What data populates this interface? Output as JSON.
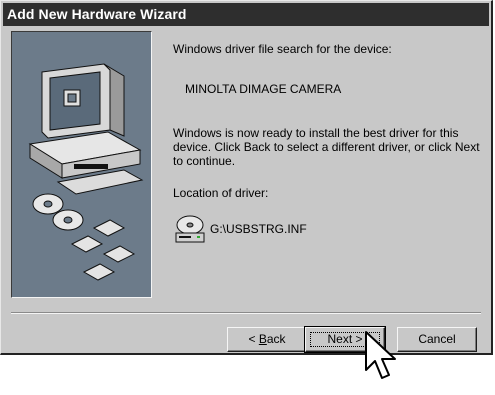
{
  "window": {
    "title": "Add New Hardware Wizard"
  },
  "content": {
    "search_label": "Windows driver file search for the device:",
    "device_name": "MINOLTA DIMAGE CAMERA",
    "ready_message": "Windows is now ready to install the best driver for this device. Click Back to select a different driver, or click Next to continue.",
    "location_label": "Location of driver:",
    "driver_path": "G:\\USBSTRG.INF",
    "driver_icon": "cd-drive-icon"
  },
  "buttons": {
    "back_prefix": "< ",
    "back_mnemonic": "B",
    "back_rest": "ack",
    "next": "Next >",
    "cancel": "Cancel"
  },
  "colors": {
    "titlebar": "#2e2e2e",
    "dialog_bg": "#c8c8c8",
    "art_bg": "#6c7b8a"
  }
}
